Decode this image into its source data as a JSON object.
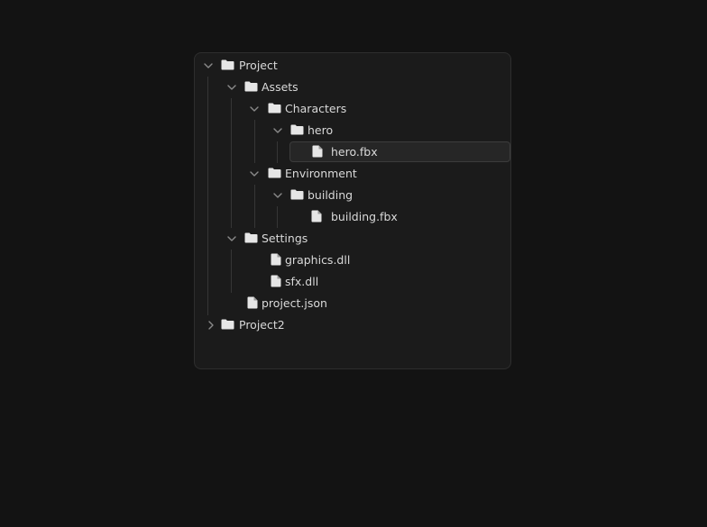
{
  "tree": {
    "nodes": [
      {
        "label": "Project",
        "icon": "folder-icon",
        "expanded": true
      },
      {
        "label": "Assets",
        "icon": "folder-icon",
        "expanded": true
      },
      {
        "label": "Characters",
        "icon": "folder-icon",
        "expanded": true
      },
      {
        "label": "hero",
        "icon": "folder-icon",
        "expanded": true
      },
      {
        "label": "hero.fbx",
        "icon": "file-icon",
        "selected": true
      },
      {
        "label": "Environment",
        "icon": "folder-icon",
        "expanded": true
      },
      {
        "label": "building",
        "icon": "folder-icon",
        "expanded": true
      },
      {
        "label": "building.fbx",
        "icon": "file-icon"
      },
      {
        "label": "Settings",
        "icon": "folder-icon",
        "expanded": true
      },
      {
        "label": "graphics.dll",
        "icon": "file-icon"
      },
      {
        "label": "sfx.dll",
        "icon": "file-icon"
      },
      {
        "label": "project.json",
        "icon": "file-icon"
      },
      {
        "label": "Project2",
        "icon": "folder-icon",
        "expanded": false
      }
    ]
  },
  "colors": {
    "background": "#131313",
    "panel": "#1b1b1b",
    "text": "#d9d9d9",
    "icon": "#e6e6e6",
    "chevron": "#8a8a8a",
    "guide": "#363636",
    "selected": "#262626"
  }
}
